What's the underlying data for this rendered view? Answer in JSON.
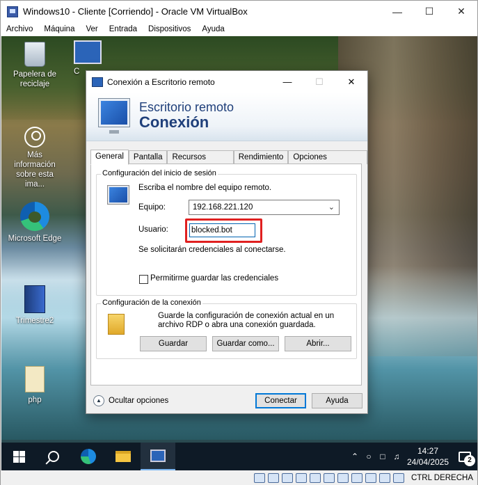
{
  "host_window": {
    "title": "Windows10 - Cliente [Corriendo] - Oracle VM VirtualBox",
    "menu": [
      "Archivo",
      "Máquina",
      "Ver",
      "Entrada",
      "Dispositivos",
      "Ayuda"
    ],
    "host_key_label": "CTRL DERECHA"
  },
  "desktop": {
    "icons": [
      {
        "label": "Papelera de reciclaje",
        "icon": "recycle-bin-icon"
      },
      {
        "label": "Más información sobre esta ima...",
        "icon": "info-icon"
      },
      {
        "label": "Microsoft Edge",
        "icon": "edge-icon"
      },
      {
        "label": "Trimestre2",
        "icon": "document-icon"
      },
      {
        "label": "php",
        "icon": "file-icon"
      },
      {
        "label": "C",
        "icon": "remote-desktop-icon"
      }
    ]
  },
  "taskbar": {
    "time": "14:27",
    "date": "24/04/2025",
    "notifications": "2"
  },
  "rdp_dialog": {
    "title": "Conexión a Escritorio remoto",
    "banner_line1": "Escritorio remoto",
    "banner_line2": "Conexión",
    "tabs": [
      "General",
      "Pantalla",
      "Recursos locales",
      "Rendimiento",
      "Opciones avanzadas"
    ],
    "login_group": {
      "legend": "Configuración del inicio de sesión",
      "instruction": "Escriba el nombre del equipo remoto.",
      "computer_label": "Equipo:",
      "computer_value": "192.168.221.120",
      "user_label": "Usuario:",
      "user_value": "blocked.bot",
      "credentials_note": "Se solicitarán credenciales al conectarse.",
      "save_credentials_label": "Permitirme guardar las credenciales"
    },
    "connection_group": {
      "legend": "Configuración de la conexión",
      "description": "Guarde la configuración de conexión actual en un archivo RDP o abra una conexión guardada.",
      "save_button": "Guardar",
      "save_as_button": "Guardar como...",
      "open_button": "Abrir..."
    },
    "hide_options": "Ocultar opciones",
    "connect_button": "Conectar",
    "help_button": "Ayuda"
  }
}
